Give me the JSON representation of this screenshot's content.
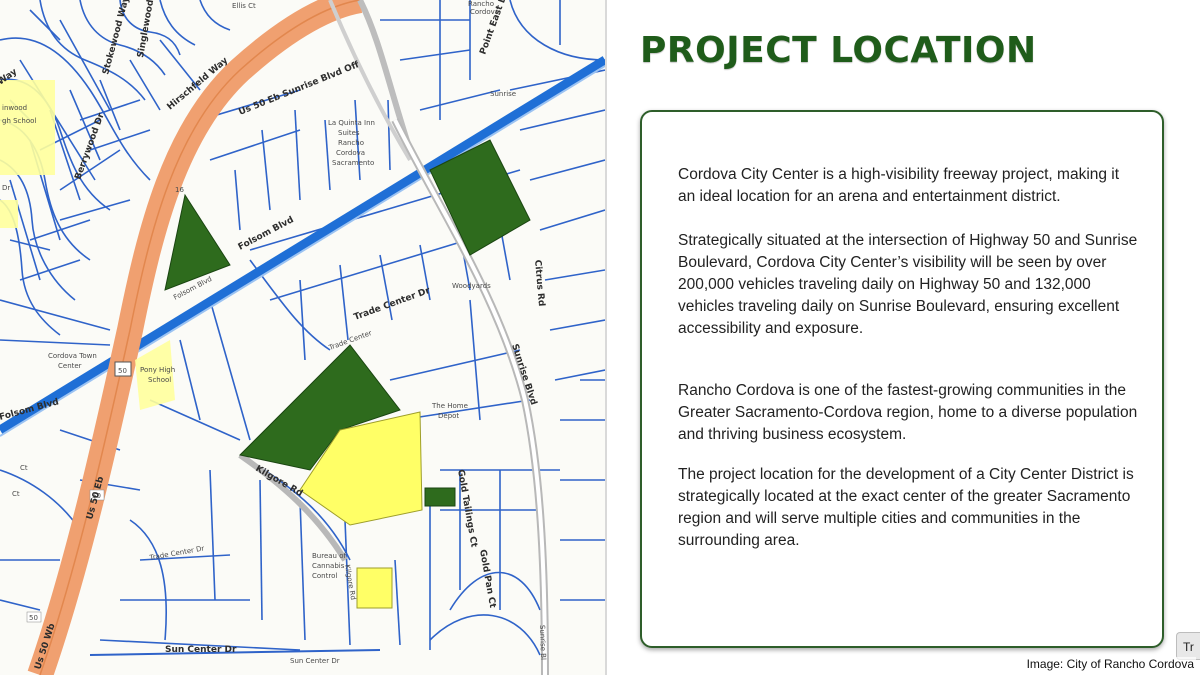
{
  "slide": {
    "title": "PROJECT LOCATION",
    "paragraphs": [
      "Cordova City Center is a high-visibility freeway project, making it an ideal location for an arena and entertainment district.",
      "Strategically situated at the intersection of Highway 50 and Sunrise Boulevard, Cordova City Center’s visibility will be seen by over 200,000 vehicles traveling daily on Highway 50 and 132,000 vehicles traveling daily on Sunrise Boulevard, ensuring excellent accessibility and exposure.",
      "Rancho Cordova is one of the fastest-growing communities in the Greater Sacramento-Cordova region, home to a diverse population and thriving business ecosystem.",
      "The project location for the development of a City Center District is strategically located at the exact center of the greater Sacramento region and will serve multiple cities and communities in the surrounding area."
    ]
  },
  "map": {
    "streets": {
      "folsom": "Folsom Blvd",
      "folsom_lower": "Folsom Blvd",
      "folsom_left": "Folsom Blvd",
      "us50_off": "Us 50 Eb Sunrise Blvd Off",
      "us50_eb": "Us 50 Eb",
      "us50_wb": "Us 50 Wb",
      "trade_center": "Trade Center Dr",
      "trade_center_lower": "Trade Center Dr",
      "trade_center_small": "Trade Center",
      "sunrise": "Sunrise Blvd",
      "sunrise_lower": "Sunrise Bl",
      "sunrise_small": "Sunrise",
      "kilgore": "Kilgore Rd",
      "sun_center": "Sun Center Dr",
      "sun_center_lower": "Sun Center Dr",
      "gold_tailings": "Gold Tailings Ct",
      "gold_pan": "Gold Pan Ct",
      "citrus": "Citrus Rd",
      "berrywood": "Berrywood Dr",
      "stokewood": "Stokewood Way",
      "singlewood": "Singlewood Way",
      "hirschfeld": "Hirschfeld Way",
      "point_east": "Point East Dr",
      "ellis": "Ellis Ct",
      "kilgore_ct": "Kilgore Rd",
      "woodyards": "Woodyards",
      "cordova_town": "Cordova Town",
      "center": "Center",
      "pony": "Pony High",
      "school": "School",
      "bureau": "Bureau of",
      "cannabis": "Cannabis",
      "control": "Control",
      "home": "The Home",
      "depot": "Depot",
      "laquinta1": "La Quinta Inn",
      "laquinta2": "Suites",
      "laquinta3": "Rancho",
      "laquinta4": "Cordova",
      "laquinta5": "Sacramento",
      "rancho": "Rancho",
      "cordova": "Cordova",
      "high_school": "gh School",
      "inwood": "inwood",
      "way_left": "Way",
      "ct_left": "Ct",
      "ct_left2": "Ct",
      "dr_left": "Dr",
      "hwy_shield": "50",
      "hwy_shield2": "50",
      "hwy_shield3": "50",
      "hwy_num": "16"
    }
  },
  "credit": "Image: City of Rancho Cordova",
  "tr_button": "Tr"
}
